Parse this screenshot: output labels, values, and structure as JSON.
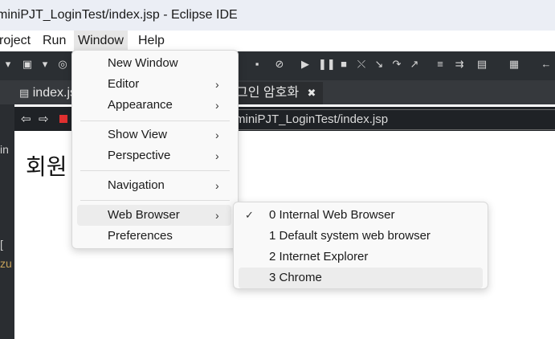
{
  "window": {
    "title": "miniPJT_LoginTest/index.jsp - Eclipse IDE"
  },
  "menubar": {
    "items": [
      "roject",
      "Run",
      "Window",
      "Help"
    ]
  },
  "editor": {
    "tabs": [
      {
        "label": "index.js"
      },
      {
        "label": "그인 암호화",
        "close_icon": "✖"
      }
    ],
    "url": "miniPJT_LoginTest/index.jsp",
    "heading": "회원"
  },
  "window_menu": {
    "items": [
      {
        "label": "New Window",
        "submenu": false
      },
      {
        "label": "Editor",
        "submenu": true
      },
      {
        "label": "Appearance",
        "submenu": true
      },
      {
        "label": "Show View",
        "submenu": true
      },
      {
        "label": "Perspective",
        "submenu": true
      },
      {
        "label": "Navigation",
        "submenu": true
      },
      {
        "label": "Web Browser",
        "submenu": true,
        "highlighted": true
      },
      {
        "label": "Preferences",
        "submenu": false
      }
    ]
  },
  "web_browser_submenu": {
    "items": [
      {
        "label": "0 Internal Web Browser",
        "checked": true
      },
      {
        "label": "1 Default system web browser",
        "checked": false
      },
      {
        "label": "2 Internet Explorer",
        "checked": false
      },
      {
        "label": "3 Chrome",
        "checked": false,
        "highlighted": true
      }
    ]
  },
  "left_gutter": {
    "glyphs": [
      "in",
      "[",
      "zu"
    ]
  },
  "icons": {
    "submenu_arrow": "›",
    "checkmark": "✓"
  },
  "colors": {
    "toolbar_bg": "#2b2f33",
    "menu_bg": "#f9f9f9",
    "highlight": "#ececec"
  }
}
